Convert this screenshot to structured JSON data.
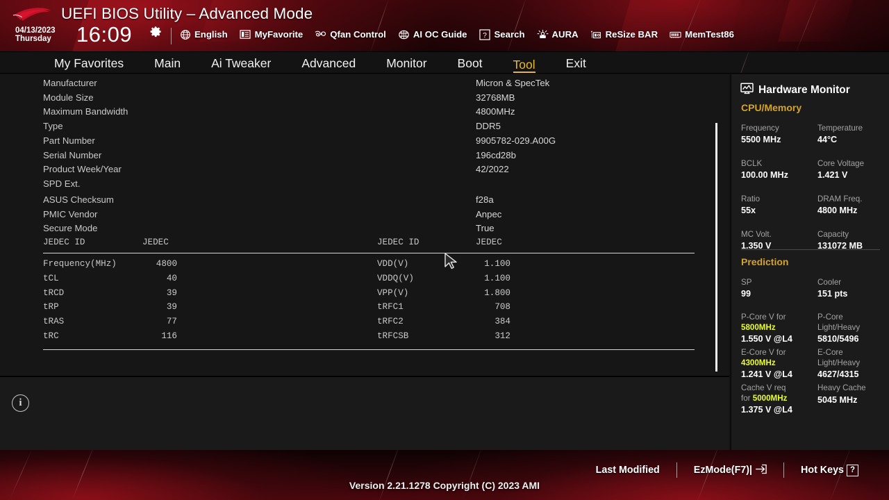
{
  "header": {
    "title": "UEFI BIOS Utility – Advanced Mode",
    "logo_name": "rog-logo",
    "date": "04/13/2023",
    "weekday": "Thursday",
    "time": "16:09",
    "gear_icon": "gear-icon",
    "items": [
      {
        "label": "English",
        "icon": "globe-icon"
      },
      {
        "label": "MyFavorite",
        "icon": "star-list-icon"
      },
      {
        "label": "Qfan Control",
        "icon": "fan-icon"
      },
      {
        "label": "AI OC Guide",
        "icon": "ai-chip-icon"
      },
      {
        "label": "Search",
        "icon": "question-box-icon"
      },
      {
        "label": "AURA",
        "icon": "aura-light-icon"
      },
      {
        "label": "ReSize BAR",
        "icon": "resize-bar-icon"
      },
      {
        "label": "MemTest86",
        "icon": "memtest-icon"
      }
    ]
  },
  "nav": {
    "active": "Tool",
    "tabs": [
      {
        "label": "My Favorites"
      },
      {
        "label": "Main"
      },
      {
        "label": "Ai Tweaker"
      },
      {
        "label": "Advanced"
      },
      {
        "label": "Monitor"
      },
      {
        "label": "Boot"
      },
      {
        "label": "Tool"
      },
      {
        "label": "Exit"
      }
    ]
  },
  "spd_info": {
    "rows": [
      {
        "key": "Manufacturer",
        "value": "Micron & SpecTek"
      },
      {
        "key": "Module Size",
        "value": "32768MB"
      },
      {
        "key": "Maximum Bandwidth",
        "value": "4800MHz"
      },
      {
        "key": "Type",
        "value": "DDR5"
      },
      {
        "key": "Part Number",
        "value": "9905782-029.A00G"
      },
      {
        "key": "Serial Number",
        "value": "196cd28b"
      },
      {
        "key": "Product Week/Year",
        "value": "42/2022"
      },
      {
        "key": "SPD Ext.",
        "value": ""
      },
      {
        "key": "ASUS Checksum",
        "value": "f28a"
      },
      {
        "key": "PMIC Vendor",
        "value": "Anpec"
      },
      {
        "key": "Secure Mode",
        "value": "True"
      }
    ],
    "jedec_row": {
      "key_left": "JEDEC ID",
      "value_left": "JEDEC",
      "key_right": "JEDEC ID",
      "value_right": "JEDEC"
    }
  },
  "timings": {
    "left": [
      {
        "key": "Frequency(MHz)",
        "value": "4800"
      },
      {
        "key": "tCL",
        "value": "40"
      },
      {
        "key": "tRCD",
        "value": "39"
      },
      {
        "key": "tRP",
        "value": "39"
      },
      {
        "key": "tRAS",
        "value": "77"
      },
      {
        "key": "tRC",
        "value": "116"
      }
    ],
    "right": [
      {
        "key": "VDD(V)",
        "value": "1.100"
      },
      {
        "key": "VDDQ(V)",
        "value": "1.100"
      },
      {
        "key": "VPP(V)",
        "value": "1.800"
      },
      {
        "key": "tRFC1",
        "value": "708"
      },
      {
        "key": "tRFC2",
        "value": "384"
      },
      {
        "key": "tRFCSB",
        "value": "312"
      }
    ]
  },
  "help": {
    "info_icon": "info-icon",
    "text": ""
  },
  "hardware_monitor": {
    "title": "Hardware Monitor",
    "title_icon": "monitor-icon",
    "cpu_memory": {
      "section": "CPU/Memory",
      "pairs": [
        {
          "l1": "Frequency",
          "v1": "5500 MHz",
          "l2": "Temperature",
          "v2": "44°C"
        },
        {
          "l1": "BCLK",
          "v1": "100.00 MHz",
          "l2": "Core Voltage",
          "v2": "1.421 V"
        },
        {
          "l1": "Ratio",
          "v1": "55x",
          "l2": "DRAM Freq.",
          "v2": "4800 MHz"
        },
        {
          "l1": "MC Volt.",
          "v1": "1.350 V",
          "l2": "Capacity",
          "v2": "131072 MB"
        }
      ]
    },
    "prediction": {
      "section": "Prediction",
      "sp_label": "SP",
      "sp_value": "99",
      "cooler_label": "Cooler",
      "cooler_value": "151 pts",
      "pcore_label_a": "P-Core V for",
      "pcore_freq": "5800MHz",
      "pcore_value": "1.550 V @L4",
      "pcore_right_a": "P-Core",
      "pcore_right_b": "Light/Heavy",
      "pcore_right_value": "5810/5496",
      "ecore_label_a": "E-Core V for",
      "ecore_freq": "4300MHz",
      "ecore_value": "1.241 V @L4",
      "ecore_right_a": "E-Core",
      "ecore_right_b": "Light/Heavy",
      "ecore_right_value": "4627/4315",
      "cache_label_a": "Cache V req",
      "cache_label_b": "for",
      "cache_freq": "5000MHz",
      "cache_value": "1.375 V @L4",
      "cache_right_a": "Heavy Cache",
      "cache_right_value": "5045 MHz"
    }
  },
  "footer": {
    "last_modified": "Last Modified",
    "ezmode": "EzMode(F7)|",
    "ezmode_icon": "arrow-into-box-icon",
    "hotkeys": "Hot Keys",
    "hotkeys_box": "?",
    "version": "Version 2.21.1278 Copyright (C) 2023 AMI"
  },
  "colors": {
    "accent_gold": "#e8b832",
    "section_gold": "#d7a326",
    "highlight_yellow": "#eaff25",
    "panel_bg": "#1b1b1b",
    "content_bg": "#161616"
  }
}
